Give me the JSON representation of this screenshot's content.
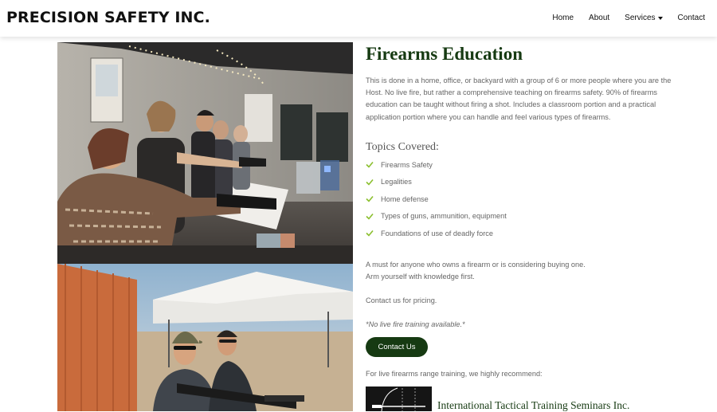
{
  "brand": {
    "name": "PRECISION SAFETY INC."
  },
  "nav": {
    "items": [
      {
        "label": "Home"
      },
      {
        "label": "About"
      },
      {
        "label": "Services",
        "has_dropdown": true
      },
      {
        "label": "Contact"
      }
    ]
  },
  "images": {
    "top": {
      "description": "Group firearms training indoors"
    },
    "bottom": {
      "description": "Outdoor range shooting"
    }
  },
  "main": {
    "title": "Firearms Education",
    "intro": "This is done in a home, office, or backyard with a group of 6 or more people where you are the Host. No live fire, but rather a comprehensive teaching on firearms safety. 90% of firearms education can be taught without firing a shot. Includes a classroom portion and a practical application portion where you can handle and feel various types of firearms.",
    "topics_heading": "Topics Covered:",
    "topics": [
      "Firearms Safety",
      "Legalities",
      "Home defense",
      "Types of guns, ammunition, equipment",
      "Foundations of use of deadly force"
    ],
    "must_line_1": "A must for anyone who owns a firearm or is considering buying one.",
    "must_line_2": "Arm yourself with knowledge first.",
    "pricing": "Contact us for pricing.",
    "note": "*No live fire training available.*",
    "contact_button": "Contact Us",
    "recommend": "For live firearms range training, we highly recommend:",
    "partner_name": "International Tactical Training Seminars Inc."
  },
  "colors": {
    "accent_green": "#163a12",
    "check_green": "#8bbf2e",
    "text_gray": "#666666"
  }
}
